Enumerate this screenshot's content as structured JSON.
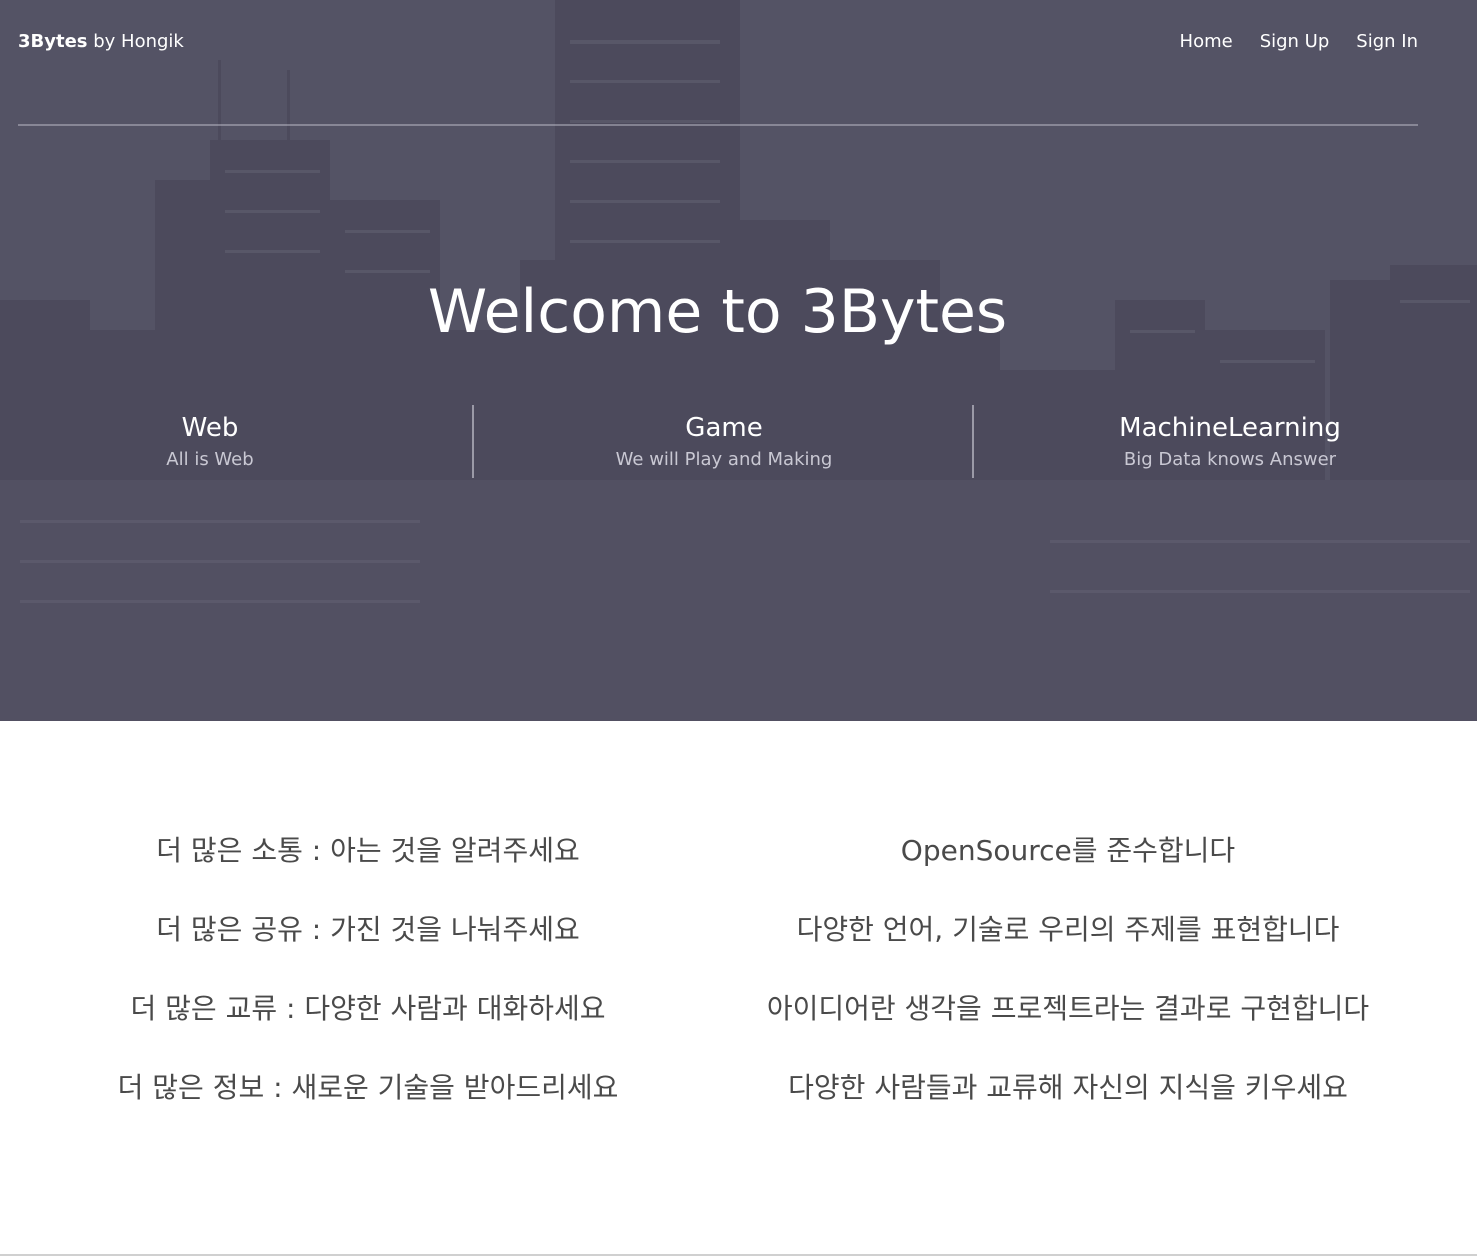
{
  "header": {
    "brand_bold": "3Bytes",
    "brand_rest": " by Hongik",
    "nav": [
      {
        "label": "Home"
      },
      {
        "label": "Sign Up"
      },
      {
        "label": "Sign In"
      }
    ]
  },
  "hero": {
    "title": "Welcome to 3Bytes",
    "features": [
      {
        "title": "Web",
        "subtitle": "All is Web"
      },
      {
        "title": "Game",
        "subtitle": "We will Play and Making"
      },
      {
        "title": "MachineLearning",
        "subtitle": "Big Data knows Answer"
      }
    ]
  },
  "content": {
    "left": [
      "더 많은 소통 : 아는 것을 알려주세요",
      "더 많은 공유 : 가진 것을 나눠주세요",
      "더 많은 교류 : 다양한 사람과 대화하세요",
      "더 많은 정보 : 새로운 기술을 받아드리세요"
    ],
    "right": [
      "OpenSource를 준수합니다",
      "다양한 언어, 기술로 우리의 주제를 표현합니다",
      "아이디어란 생각을 프로젝트라는 결과로 구현합니다",
      "다양한 사람들과 교류해 자신의 지식을 키우세요"
    ]
  },
  "colors": {
    "hero_overlay": "#5a5968",
    "text_light": "#ffffff",
    "subtitle": "#c9c8d3",
    "body_text": "#4a4a4a"
  }
}
